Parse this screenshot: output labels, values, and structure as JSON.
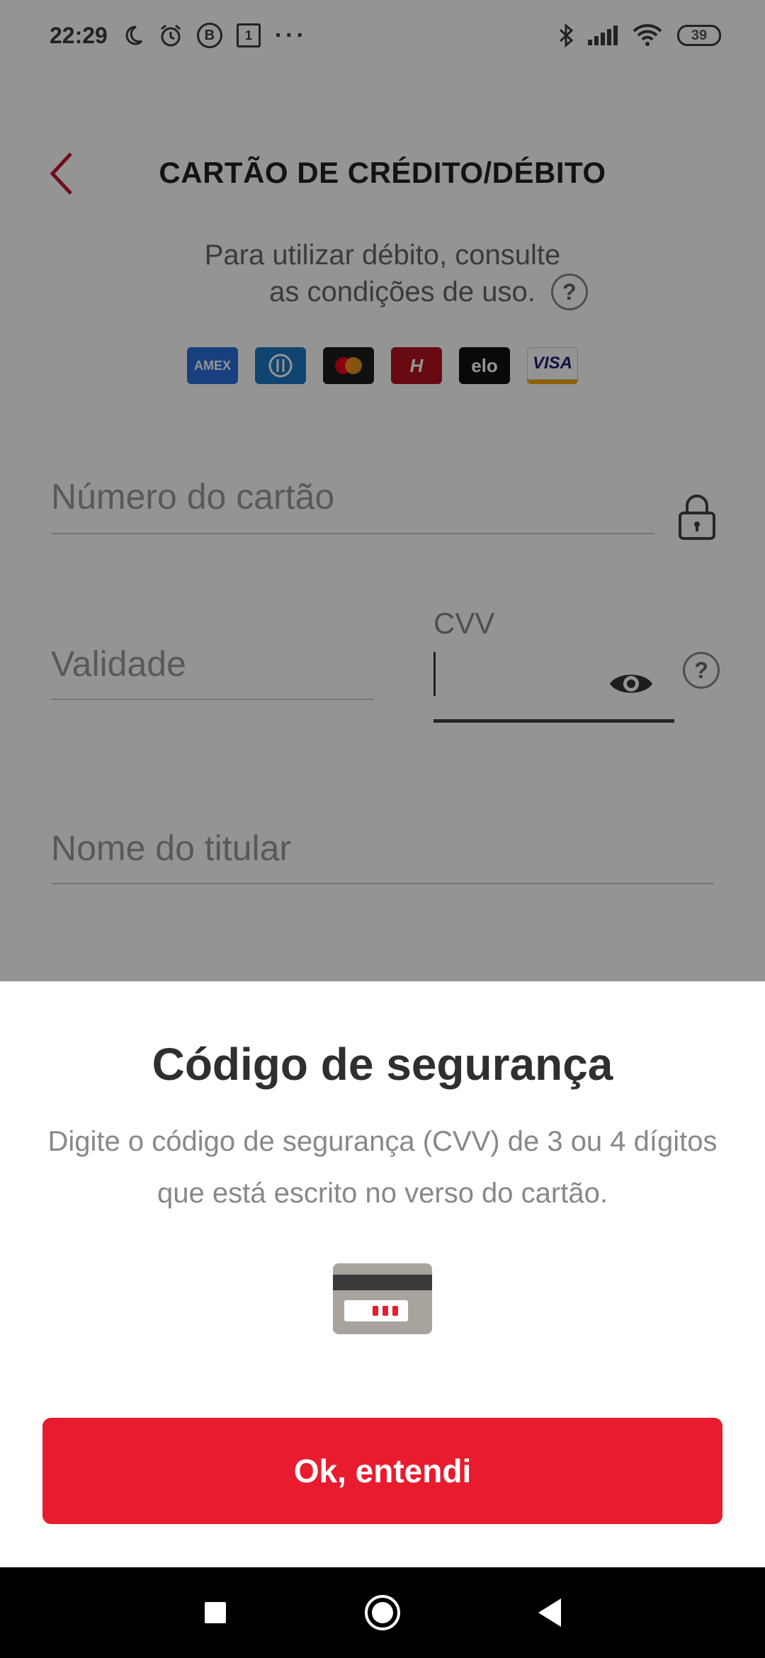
{
  "status_bar": {
    "time": "22:29",
    "icons": [
      "moon-icon",
      "alarm-icon",
      "b-icon",
      "calendar-icon",
      "more-icon",
      "bluetooth-icon",
      "signal-icon",
      "wifi-icon"
    ],
    "b_letter": "B",
    "calendar_day": "1",
    "more": "···",
    "battery": "39"
  },
  "header": {
    "title": "CARTÃO DE CRÉDITO/DÉBITO",
    "back_color": "#c0182a"
  },
  "hint": {
    "line1": "Para utilizar débito, consulte",
    "line2": "as condições de uso.",
    "help": "?"
  },
  "brands": [
    "AMEX",
    "Diners",
    "Mastercard",
    "H",
    "elo",
    "VISA"
  ],
  "form": {
    "card_number_placeholder": "Número do cartão",
    "expiry_placeholder": "Validade",
    "cvv_label": "CVV",
    "cvv_value": "",
    "holder_placeholder": "Nome do titular",
    "cvv_help": "?"
  },
  "sheet": {
    "title": "Código de segurança",
    "description": "Digite o código de segurança (CVV) de 3 ou 4 dígitos que está escrito no verso do cartão.",
    "button_label": "Ok, entendi",
    "button_color": "#e81c2e"
  }
}
